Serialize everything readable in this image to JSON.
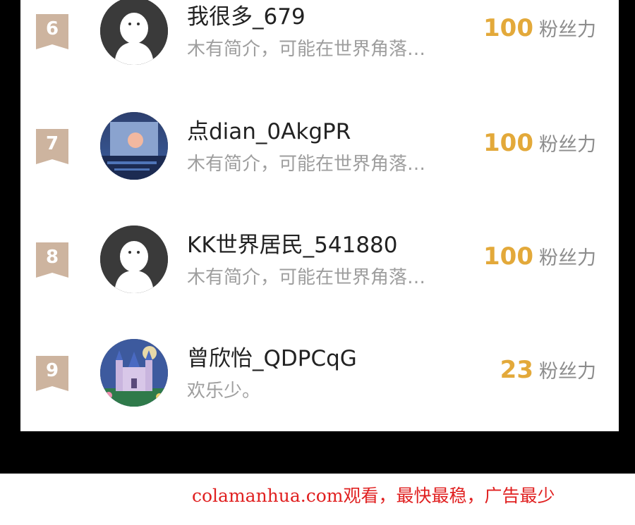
{
  "rows": [
    {
      "rank": "6",
      "username": "我很多_679",
      "bio": "木有简介，可能在世界角落…",
      "fans_count": "100",
      "fans_label": "粉丝力",
      "avatar": "default-person-avatar"
    },
    {
      "rank": "7",
      "username": "点dian_0AkgPR",
      "bio": "木有简介，可能在世界角落…",
      "fans_count": "100",
      "fans_label": "粉丝力",
      "avatar": "moon-scene-avatar"
    },
    {
      "rank": "8",
      "username": "KK世界居民_541880",
      "bio": "木有简介，可能在世界角落…",
      "fans_count": "100",
      "fans_label": "粉丝力",
      "avatar": "default-person-avatar"
    },
    {
      "rank": "9",
      "username": "曾欣怡_QDPCqG",
      "bio": "欢乐少。",
      "fans_count": "23",
      "fans_label": "粉丝力",
      "avatar": "castle-avatar"
    }
  ],
  "watermark": "colamanhua.com观看，最快最稳，广告最少",
  "colors": {
    "rank_badge": "#cdb49f",
    "fans_count": "#e3a93a",
    "watermark": "#e02020"
  }
}
